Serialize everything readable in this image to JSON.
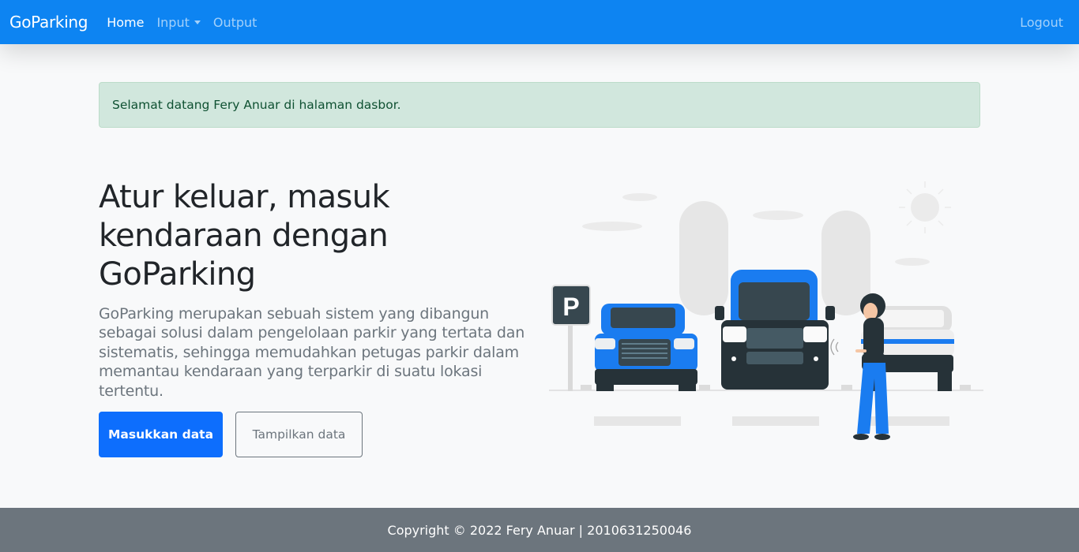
{
  "navbar": {
    "brand": "GoParking",
    "links": [
      {
        "label": "Home"
      },
      {
        "label": "Input"
      },
      {
        "label": "Output"
      }
    ],
    "logout": "Logout"
  },
  "alert": {
    "text": "Selamat datang Fery Anuar di halaman dasbor."
  },
  "hero": {
    "title": "Atur keluar, masuk kendaraan dengan GoParking",
    "description": "GoParking merupakan sebuah sistem yang dibangun sebagai solusi dalam pengelolaan parkir yang tertata dan sistematis, sehingga memudahkan petugas parkir dalam memantau kendaraan yang terparkir di suatu lokasi tertentu.",
    "primary_button": "Masukkan data",
    "secondary_button": "Tampilkan data"
  },
  "illustration": {
    "sign_letter": "P"
  },
  "footer": {
    "text": "Copyright © 2022 Fery Anuar | 2010631250046"
  },
  "colors": {
    "navbar": "#0d84f2",
    "primary": "#0d6efd",
    "alert_bg": "#d1e7dd",
    "footer": "#6c757d",
    "car_blue": "#1a7cf0"
  }
}
